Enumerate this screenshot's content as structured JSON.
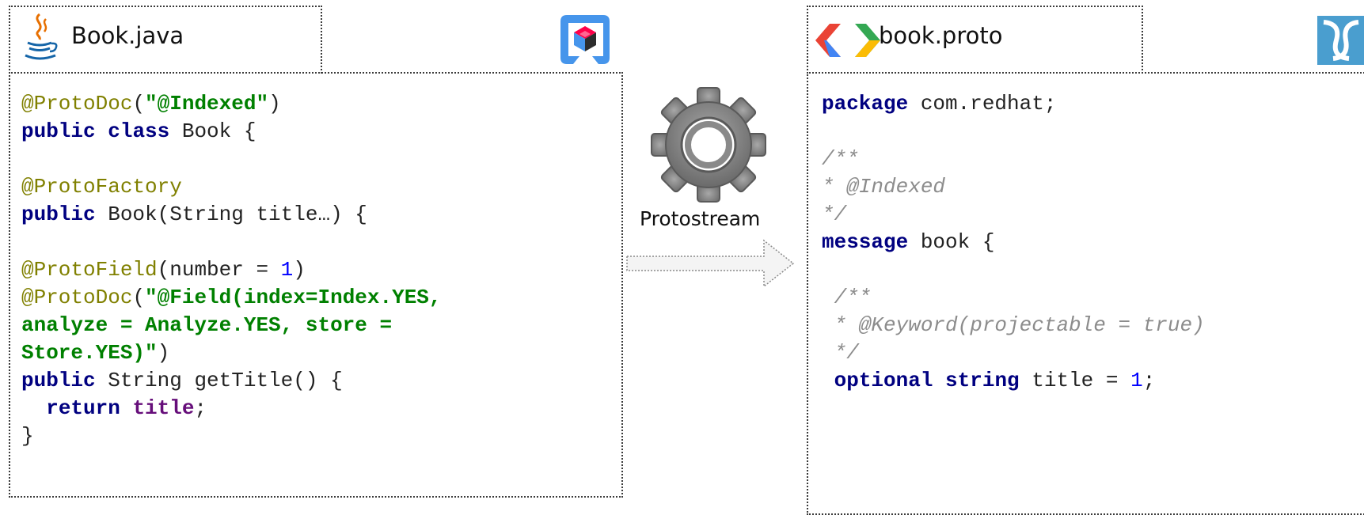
{
  "left": {
    "title": "Book.java",
    "icons": [
      "java-cup-icon",
      "quarkus-icon"
    ],
    "lines": [
      [
        {
          "t": "@ProtoDoc",
          "c": "ann"
        },
        {
          "t": "(",
          "c": "p"
        },
        {
          "t": "\"@Indexed\"",
          "c": "str"
        },
        {
          "t": ")",
          "c": "p"
        }
      ],
      [
        {
          "t": "public",
          "c": "kw"
        },
        {
          "t": " ",
          "c": "p"
        },
        {
          "t": "class",
          "c": "kw"
        },
        {
          "t": " Book {",
          "c": "p"
        }
      ],
      [],
      [
        {
          "t": "@ProtoFactory",
          "c": "ann"
        }
      ],
      [
        {
          "t": "public",
          "c": "kw"
        },
        {
          "t": " Book(String title…) {",
          "c": "p"
        }
      ],
      [],
      [
        {
          "t": "@ProtoField",
          "c": "ann"
        },
        {
          "t": "(number = ",
          "c": "p"
        },
        {
          "t": "1",
          "c": "num"
        },
        {
          "t": ")",
          "c": "p"
        }
      ],
      [
        {
          "t": "@ProtoDoc",
          "c": "ann"
        },
        {
          "t": "(",
          "c": "p"
        },
        {
          "t": "\"@Field(index=Index.YES,",
          "c": "str"
        }
      ],
      [
        {
          "t": "analyze = Analyze.YES, store =",
          "c": "str"
        }
      ],
      [
        {
          "t": "Store.YES)\"",
          "c": "str"
        },
        {
          "t": ")",
          "c": "p"
        }
      ],
      [
        {
          "t": "public",
          "c": "kw"
        },
        {
          "t": " String getTitle() {",
          "c": "p"
        }
      ],
      [
        {
          "t": "  ",
          "c": "p"
        },
        {
          "t": "return",
          "c": "kw"
        },
        {
          "t": " ",
          "c": "p"
        },
        {
          "t": "title",
          "c": "fld"
        },
        {
          "t": ";",
          "c": "p"
        }
      ],
      [
        {
          "t": "}",
          "c": "p"
        }
      ]
    ]
  },
  "middle": {
    "label": "Protostream",
    "icons": [
      "gear-icon",
      "arrow-right-icon"
    ]
  },
  "right": {
    "title": "book.proto",
    "icons": [
      "protobuf-chevrons-icon",
      "infinispan-icon"
    ],
    "lines": [
      [
        {
          "t": "package",
          "c": "kw"
        },
        {
          "t": " com.redhat;",
          "c": "p"
        }
      ],
      [],
      [
        {
          "t": "/**",
          "c": "cmt"
        }
      ],
      [
        {
          "t": "* @Indexed",
          "c": "cmt"
        }
      ],
      [
        {
          "t": "*/",
          "c": "cmt"
        }
      ],
      [
        {
          "t": "message",
          "c": "kw"
        },
        {
          "t": " book {",
          "c": "p"
        }
      ],
      [],
      [
        {
          "t": " /**",
          "c": "cmt"
        }
      ],
      [
        {
          "t": " * @Keyword(projectable = true)",
          "c": "cmt"
        }
      ],
      [
        {
          "t": " */",
          "c": "cmt"
        }
      ],
      [
        {
          "t": " ",
          "c": "p"
        },
        {
          "t": "optional",
          "c": "kw"
        },
        {
          "t": " ",
          "c": "p"
        },
        {
          "t": "string",
          "c": "kw"
        },
        {
          "t": " title = ",
          "c": "p"
        },
        {
          "t": "1",
          "c": "num"
        },
        {
          "t": ";",
          "c": "p"
        }
      ]
    ]
  }
}
